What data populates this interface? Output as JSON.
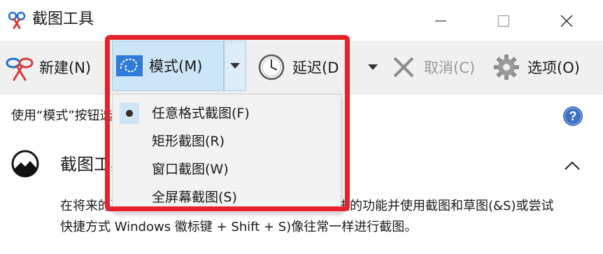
{
  "window": {
    "title": "截图工具",
    "app_icon": "snipping-tool-icon",
    "controls": [
      "minimize-icon",
      "maximize-icon",
      "close-icon"
    ]
  },
  "toolbar": {
    "new_label": "新建(N)",
    "mode_label": "模式(M)",
    "delay_label": "延迟(D",
    "cancel_label": "取消(C)",
    "options_label": "选项(O)",
    "icons": [
      "scissors-icon",
      "free-form-snip-icon",
      "dropdown-arrow-icon",
      "clock-icon",
      "close-x-icon",
      "gear-icon"
    ]
  },
  "hint": {
    "text": "使用“模式”按钮选择截图类型，或单击“新建”按钮。",
    "help_icon": "help-icon"
  },
  "info_panel": {
    "title": "截图工具正在移动...",
    "body": "在将来的更新中，截图工具将移到新的家。尝试改进的功能并使用截图和草图(&S)或尝试快捷方式 Windows 徽标键 + Shift + S)像往常一样进行截图。",
    "icon": "snip-sketch-icon"
  },
  "mode_menu": {
    "items": [
      {
        "label": "任意格式截图(F)",
        "selected": true
      },
      {
        "label": "矩形截图(R)",
        "selected": false
      },
      {
        "label": "窗口截图(W)",
        "selected": false
      },
      {
        "label": "全屏幕截图(S)",
        "selected": false
      }
    ]
  },
  "colors": {
    "highlight_border": "#e5222a",
    "toolbar_bg": "#f0f0f0",
    "selected_bg": "#cde6f7",
    "help_blue": "#3c6fc4",
    "disabled_text": "#9a9a9a"
  }
}
